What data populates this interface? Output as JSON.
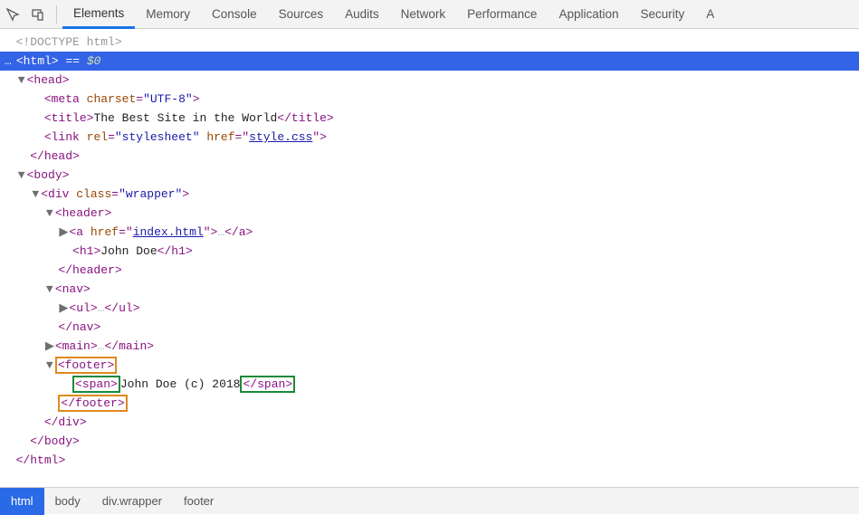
{
  "tabs": {
    "elements": "Elements",
    "memory": "Memory",
    "console": "Console",
    "sources": "Sources",
    "audits": "Audits",
    "network": "Network",
    "performance": "Performance",
    "application": "Application",
    "security": "Security",
    "more": "A"
  },
  "dom": {
    "doctype": "<!DOCTYPE html>",
    "html_open": "html",
    "selected_suffix": " == ",
    "dollar0": "$0",
    "head": "head",
    "meta": {
      "tag": "meta",
      "attr1_name": "charset",
      "attr1_val": "\"UTF-8\""
    },
    "title": {
      "tag": "title",
      "text": "The Best Site in the World"
    },
    "link": {
      "tag": "link",
      "rel_name": "rel",
      "rel_val": "\"stylesheet\"",
      "href_name": "href",
      "href_val": "style.css"
    },
    "body": "body",
    "div": {
      "tag": "div",
      "class_name": "class",
      "class_val": "\"wrapper\""
    },
    "header": "header",
    "a": {
      "tag": "a",
      "href_name": "href",
      "href_val": "index.html"
    },
    "h1": {
      "tag": "h1",
      "text": "John Doe"
    },
    "nav": "nav",
    "ul": "ul",
    "main": "main",
    "footer": "footer",
    "span": {
      "tag": "span",
      "text": "John Doe (c) 2018"
    },
    "ellipsis": "…"
  },
  "breadcrumb": {
    "html": "html",
    "body": "body",
    "div": "div.wrapper",
    "footer": "footer"
  }
}
